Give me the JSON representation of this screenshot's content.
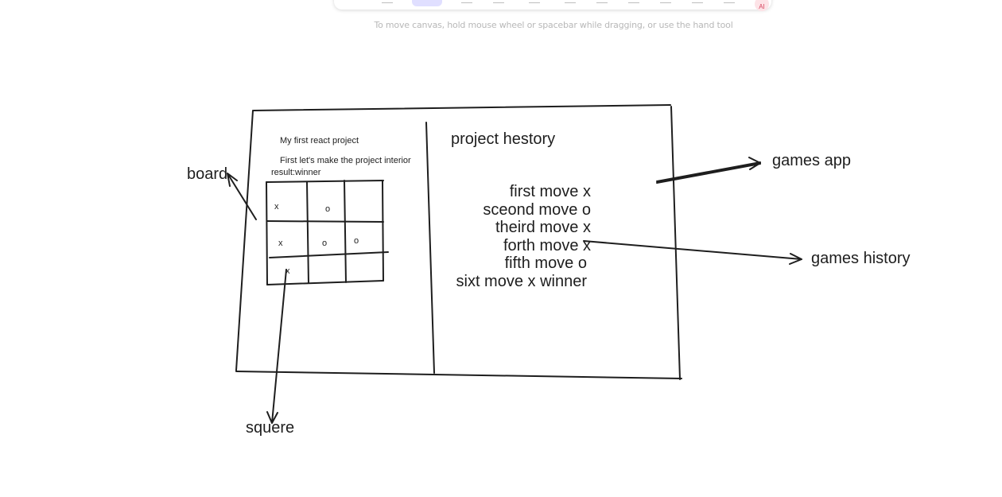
{
  "toolbar": {
    "ai_badge": "AI"
  },
  "hint": "To move canvas, hold mouse wheel or spacebar while dragging, or use the hand tool",
  "drawing": {
    "left_panel": {
      "title": "My first react project",
      "subtitle": "First let's make the project interior",
      "result": "result:winner"
    },
    "board_cells": [
      "x",
      "o",
      "x",
      "o",
      "o",
      "x"
    ],
    "right_panel": {
      "title": "project hestory",
      "moves": [
        "first move x",
        "sceond move o",
        "theird move x",
        "forth move x",
        "fifth move o",
        "sixt move x winner"
      ]
    },
    "labels": {
      "board": "board",
      "squere": "squere",
      "games_app": "games app",
      "games_history": "games history"
    }
  },
  "colors": {
    "stroke": "#1e1e1e",
    "hint": "#b8b8b8",
    "toolbar_active": "#e0dfff",
    "badge_bg": "#fde3e7",
    "badge_text": "#d6455f"
  }
}
